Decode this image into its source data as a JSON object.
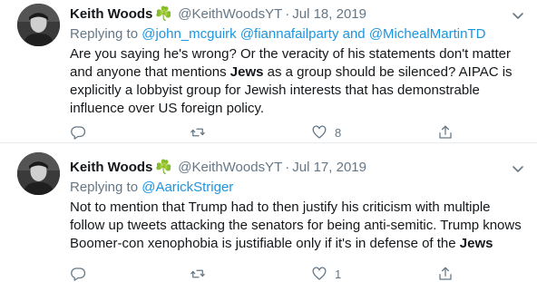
{
  "tweets": [
    {
      "author_name": "Keith Woods",
      "emoji": "☘️",
      "handle": "@KeithWoodsYT",
      "separator": "·",
      "date": "Jul 18, 2019",
      "replying_prefix": "Replying to ",
      "mentions": [
        "@john_mcguirk",
        "@fiannafailparty",
        "@MichealMartinTD"
      ],
      "replying_join": "and",
      "text_parts": [
        "Are you saying he's wrong? Or the veracity of his statements don't matter and anyone that mentions ",
        "Jews",
        " as a group should be silenced? AIPAC is explicitly a lobbyist group for Jewish interests that has demonstrable influence over US foreign policy."
      ],
      "reply_count": "",
      "retweet_count": "",
      "like_count": "8"
    },
    {
      "author_name": "Keith Woods",
      "emoji": "☘️",
      "handle": "@KeithWoodsYT",
      "separator": "·",
      "date": "Jul 17, 2019",
      "replying_prefix": "Replying to ",
      "mentions": [
        "@AarickStriger"
      ],
      "text_parts": [
        "Not to mention that Trump had to then justify his criticism with multiple follow up tweets attacking the senators for being anti-semitic. Trump knows Boomer-con xenophobia is justifiable only if it's in defense of the ",
        "Jews"
      ],
      "reply_count": "",
      "retweet_count": "",
      "like_count": "1"
    }
  ],
  "icons": {
    "reply": "reply-icon",
    "retweet": "retweet-icon",
    "like": "heart-icon",
    "share": "share-icon",
    "caret": "chevron-down-icon"
  },
  "colors": {
    "link": "#1b95e0",
    "secondary_text": "#657786",
    "primary_text": "#14171a",
    "divider": "#e6ecf0",
    "shamrock": "#4caf50"
  }
}
